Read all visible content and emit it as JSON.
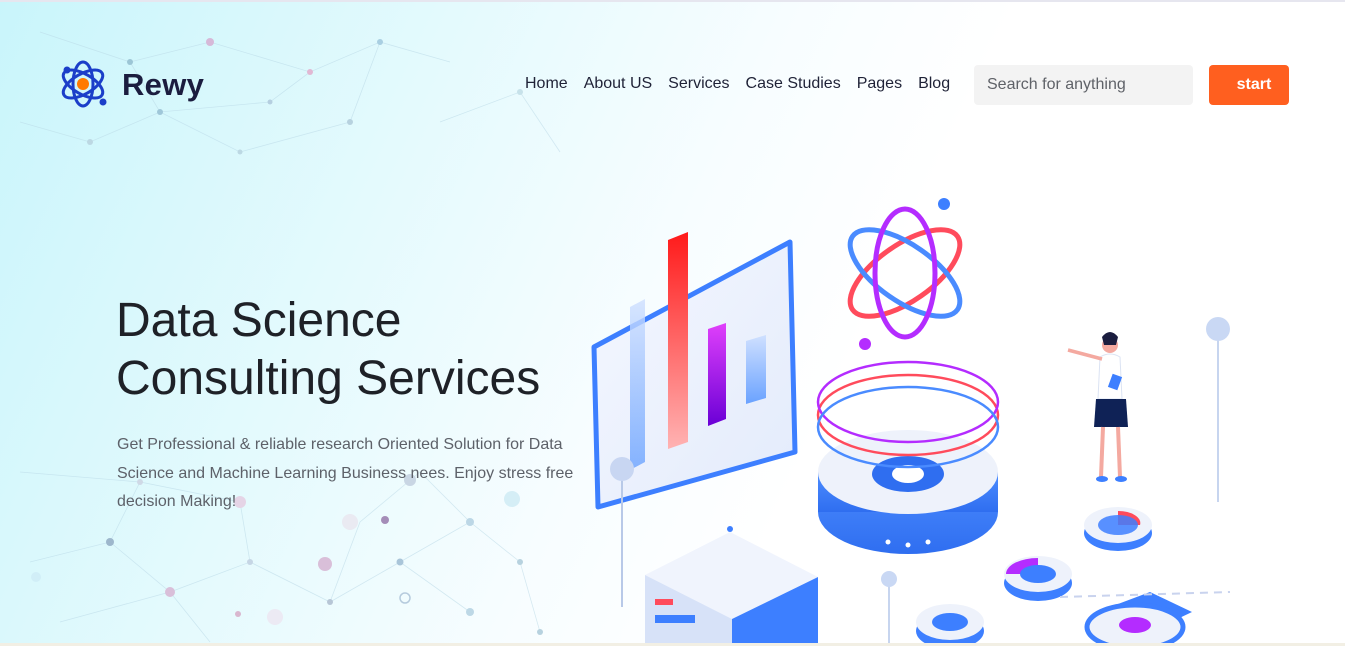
{
  "brand": {
    "name": "Rewy",
    "logo_icon": "atom-icon"
  },
  "nav": {
    "items": [
      "Home",
      "About US",
      "Services",
      "Case Studies",
      "Pages",
      "Blog"
    ]
  },
  "search": {
    "placeholder": "Search for anything"
  },
  "cta": {
    "label": "start"
  },
  "hero": {
    "title_line1": "Data Science",
    "title_line2": "Consulting Services",
    "description": "Get Professional & reliable research Oriented Solution for Data Science and Machine Learning Business nees. Enjoy stress free decision Making!"
  },
  "colors": {
    "accent": "#ff5f1f",
    "brand_text": "#1b1d3f",
    "logo_blue": "#1b3ec9",
    "logo_orange": "#ff7a00"
  }
}
